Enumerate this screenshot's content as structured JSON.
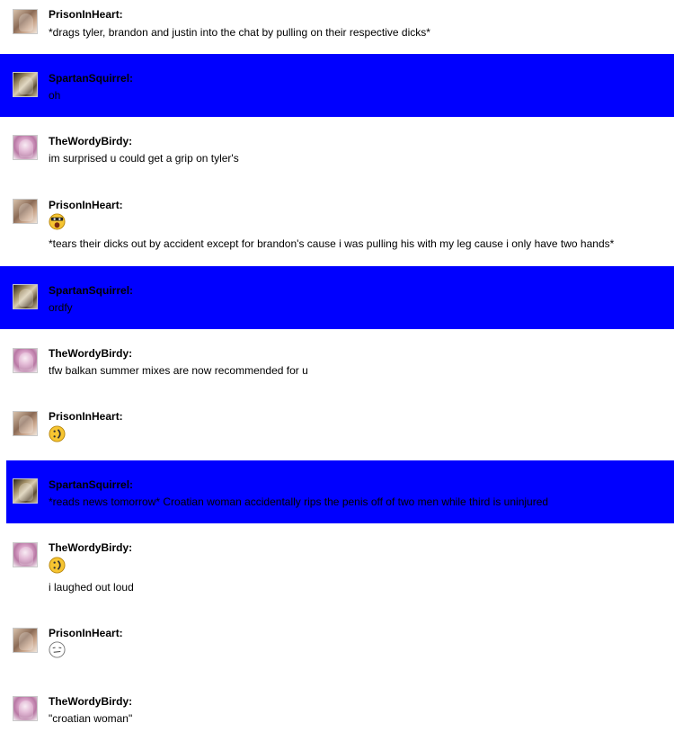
{
  "messages": [
    {
      "user": "PrisonInHeart:",
      "text": "*drags tyler, brandon and justin into the chat by pulling on their respective dicks*"
    },
    {
      "user": "SpartanSquirrel:",
      "text": "oh"
    },
    {
      "user": "TheWordyBirdy:",
      "text": "im surprised u could get a grip on tyler's"
    },
    {
      "user": "PrisonInHeart:",
      "emoji": "surprised-face-icon",
      "text": "*tears their dicks out by accident except for brandon's cause i was pulling his with my leg cause i only have two hands*"
    },
    {
      "user": "SpartanSquirrel:",
      "text": "ordfy"
    },
    {
      "user": "TheWordyBirdy:",
      "text": "tfw balkan summer mixes are now recommended for u"
    },
    {
      "user": "PrisonInHeart:",
      "emoji": "laughing-face-icon"
    },
    {
      "user": "SpartanSquirrel:",
      "text": "*reads news tomorrow* Croatian woman accidentally rips the penis off of two men while third is uninjured"
    },
    {
      "user": "TheWordyBirdy:",
      "emoji": "laughing-face-icon",
      "text": "i laughed out loud"
    },
    {
      "user": "PrisonInHeart:",
      "emoji": "meh-face-icon"
    },
    {
      "user": "TheWordyBirdy:",
      "text": "\"croatian woman\""
    }
  ],
  "colors": {
    "highlight": "#0000ff",
    "emoji_yellow": "#f6c531",
    "emoji_outline": "#b8860b"
  }
}
